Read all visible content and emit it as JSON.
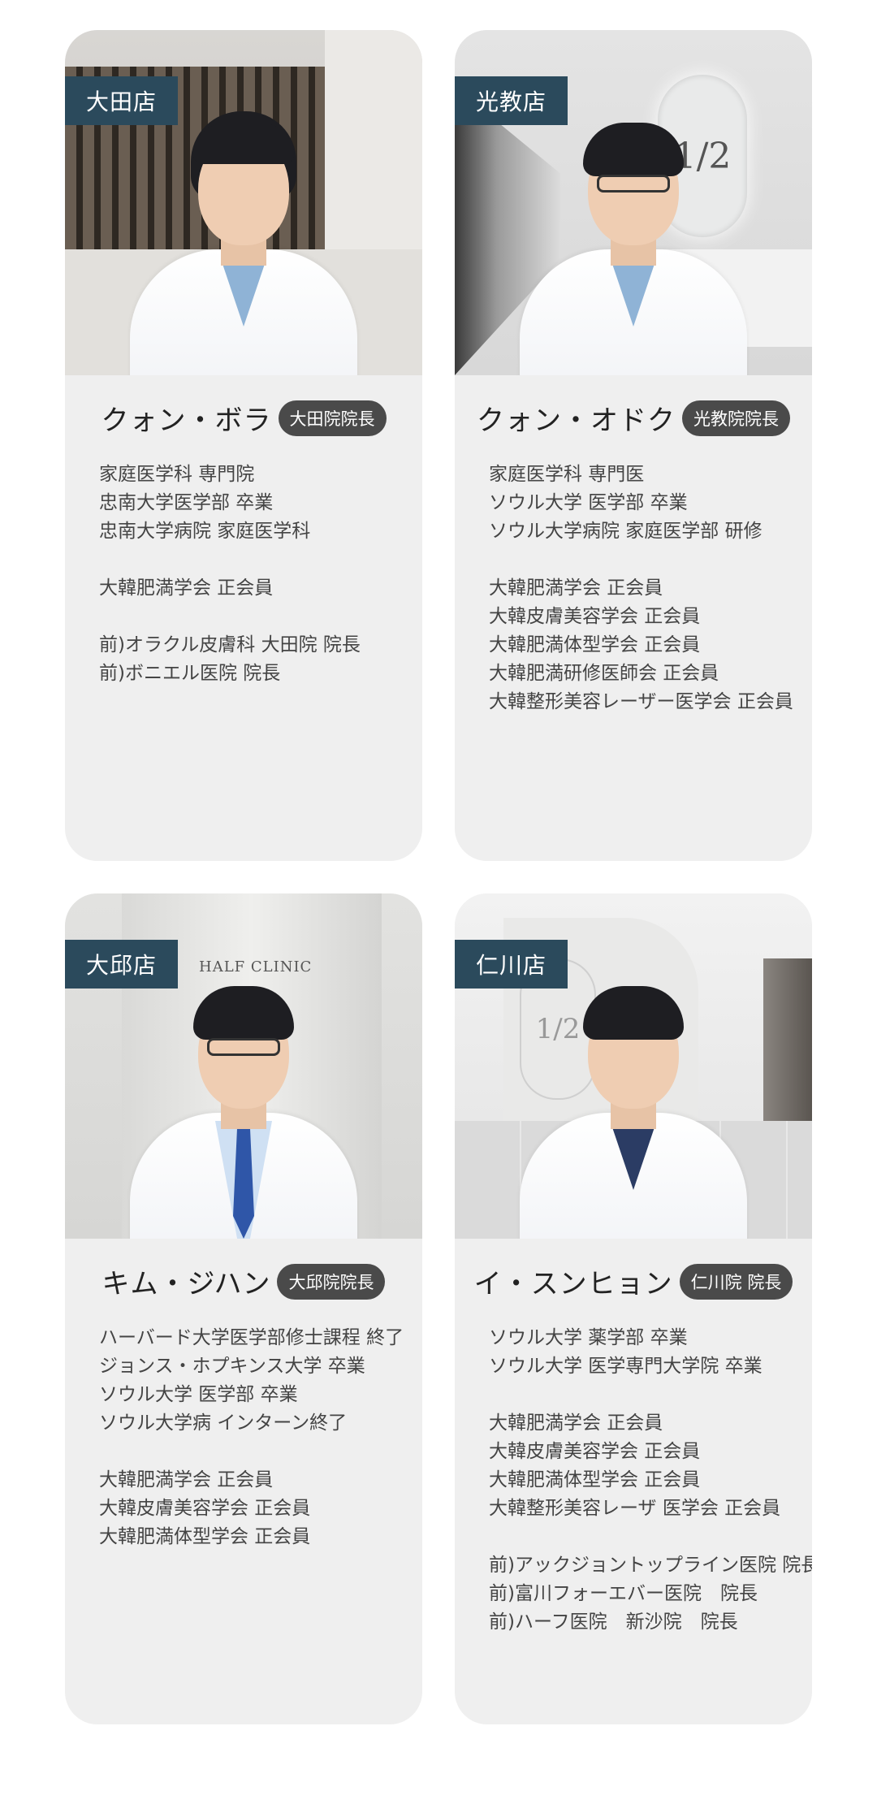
{
  "doctors": [
    {
      "branch": "大田店",
      "name": "クォン・ボラ",
      "role": "大田院院長",
      "credentials": [
        "家庭医学科 専門院",
        "忠南大学医学部 卒業",
        "忠南大学病院 家庭医学科",
        "",
        "大韓肥満学会 正会員",
        "",
        "前)オラクル皮膚科 大田院 院長",
        "前)ボニエル医院 院長"
      ]
    },
    {
      "branch": "光教店",
      "name": "クォン・オドク",
      "role": "光教院院長",
      "credentials": [
        "家庭医学科 専門医",
        "ソウル大学 医学部 卒業",
        "ソウル大学病院 家庭医学部 研修",
        "",
        "大韓肥満学会 正会員",
        "大韓皮膚美容学会 正会員",
        "大韓肥満体型学会 正会員",
        "大韓肥満研修医師会 正会員",
        "大韓整形美容レーザー医学会 正会員"
      ]
    },
    {
      "branch": "大邱店",
      "name": "キム・ジハン",
      "role": "大邱院院長",
      "credentials": [
        "ハーバード大学医学部修士課程 終了",
        "ジョンス・ホプキンス大学 卒業",
        "ソウル大学 医学部 卒業",
        "ソウル大学病 インターン終了",
        "",
        "大韓肥満学会 正会員",
        "大韓皮膚美容学会 正会員",
        "大韓肥満体型学会 正会員"
      ]
    },
    {
      "branch": "仁川店",
      "name": "イ・スンヒョン",
      "role": "仁川院 院長",
      "credentials": [
        "ソウル大学 薬学部 卒業",
        "ソウル大学 医学専門大学院 卒業",
        "",
        "大韓肥満学会 正会員",
        "大韓皮膚美容学会 正会員",
        "大韓肥満体型学会 正会員",
        "大韓整形美容レーザ 医学会 正会員",
        "",
        "前)アックジョントップライン医院 院長",
        "前)富川フォーエバー医院　院長",
        "前)ハーフ医院　新沙院　院長"
      ]
    }
  ],
  "decor": {
    "logo_text": "HALF CLINIC",
    "mirror_text": "1/2",
    "badge_color": "#2b4a5c",
    "role_pill_color": "#4a4a4a",
    "card_bg": "#efefef"
  }
}
